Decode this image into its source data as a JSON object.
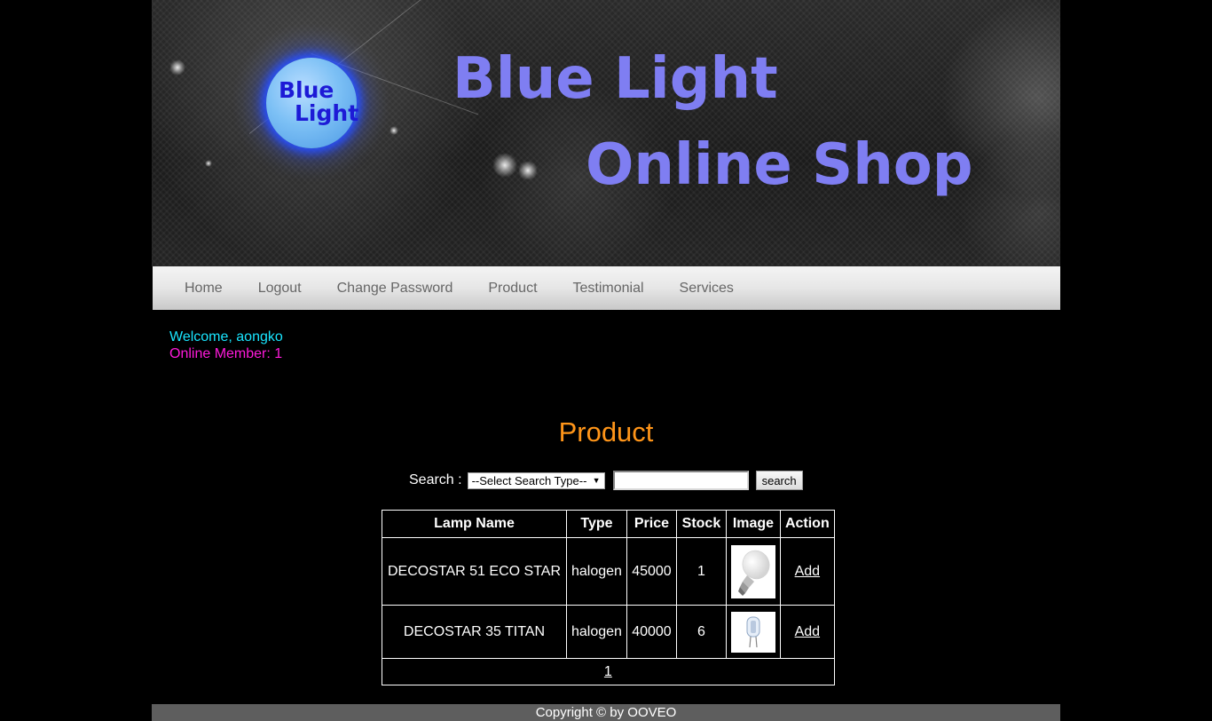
{
  "banner": {
    "logo_line1": "Blue",
    "logo_line2": "Light",
    "title_line1": "Blue Light",
    "title_line2": "Online Shop"
  },
  "nav": {
    "items": [
      {
        "label": "Home"
      },
      {
        "label": "Logout"
      },
      {
        "label": "Change Password"
      },
      {
        "label": "Product"
      },
      {
        "label": "Testimonial"
      },
      {
        "label": "Services"
      }
    ]
  },
  "welcome": {
    "greeting": "Welcome, aongko",
    "online": "Online Member: 1"
  },
  "main": {
    "heading": "Product",
    "search": {
      "label": "Search :",
      "select_value": "--Select Search Type--",
      "input_value": "",
      "button_label": "search"
    },
    "table": {
      "headers": [
        "Lamp Name",
        "Type",
        "Price",
        "Stock",
        "Image",
        "Action"
      ],
      "rows": [
        {
          "name": "DECOSTAR 51 ECO STAR",
          "type": "halogen",
          "price": "45000",
          "stock": "1",
          "image_icon": "led-bulb-image",
          "action": "Add"
        },
        {
          "name": "DECOSTAR 35 TITAN",
          "type": "halogen",
          "price": "40000",
          "stock": "6",
          "image_icon": "capsule-halogen-image",
          "action": "Add"
        }
      ],
      "pages": [
        "1"
      ]
    }
  },
  "footer": {
    "text": "Copyright © by OOVEO"
  },
  "colors": {
    "heading": "#ff9519",
    "welcome": "#19e5ff",
    "online": "#ff1adb",
    "title": "#7f7ef2"
  }
}
